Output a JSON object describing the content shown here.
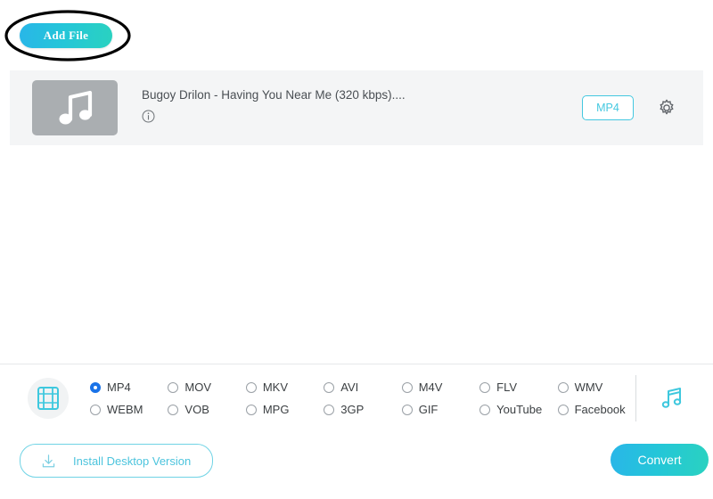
{
  "toolbar": {
    "add_file_label": "Add File"
  },
  "annotation": {
    "shape": "ellipse-highlight",
    "color": "#000000"
  },
  "file_row": {
    "thumbnail_icon": "music-note-icon",
    "file_name": "Bugoy Drilon - Having You Near Me (320 kbps)....",
    "info_icon": "info-icon",
    "output_format_badge": "MP4",
    "settings_icon": "gear-icon"
  },
  "format_section": {
    "video_tab_icon": "film-strip-icon",
    "audio_tab_icon": "music-note-icon",
    "selected_format": "MP4",
    "formats": [
      {
        "label": "MP4",
        "selected": true
      },
      {
        "label": "MOV",
        "selected": false
      },
      {
        "label": "MKV",
        "selected": false
      },
      {
        "label": "AVI",
        "selected": false
      },
      {
        "label": "M4V",
        "selected": false
      },
      {
        "label": "FLV",
        "selected": false
      },
      {
        "label": "WMV",
        "selected": false
      },
      {
        "label": "WEBM",
        "selected": false
      },
      {
        "label": "VOB",
        "selected": false
      },
      {
        "label": "MPG",
        "selected": false
      },
      {
        "label": "3GP",
        "selected": false
      },
      {
        "label": "GIF",
        "selected": false
      },
      {
        "label": "YouTube",
        "selected": false
      },
      {
        "label": "Facebook",
        "selected": false
      }
    ]
  },
  "footer": {
    "install_label": "Install Desktop Version",
    "install_icon": "download-icon",
    "convert_label": "Convert"
  },
  "colors": {
    "accent_cyan": "#2ac4d8",
    "accent_gradient_start": "#29b6e8",
    "accent_gradient_end": "#2ad2c0",
    "radio_selected_blue": "#1a73e8",
    "row_background": "#f4f5f6",
    "thumbnail_gray": "#aaaeb1"
  }
}
